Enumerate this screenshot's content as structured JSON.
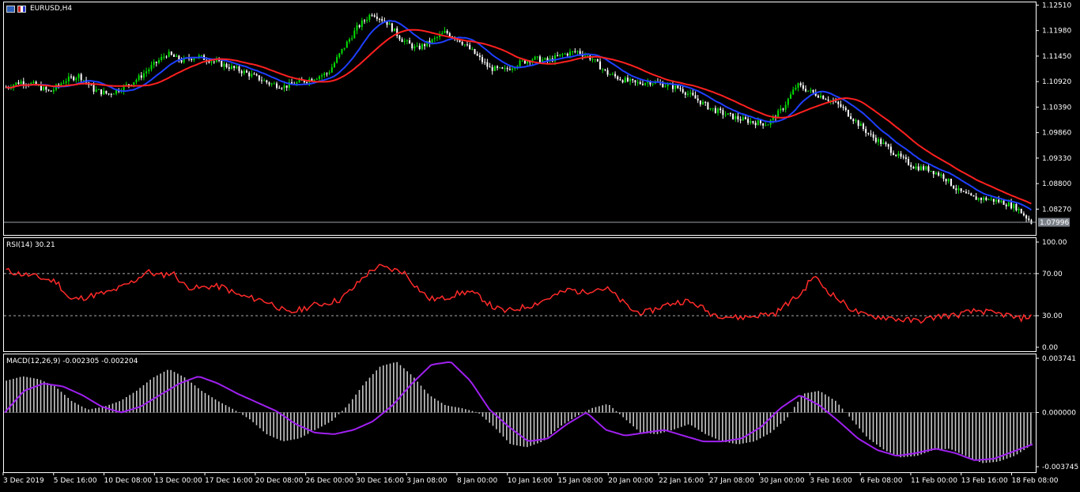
{
  "colors": {
    "background": "#000000",
    "candle_bull": "#00e000",
    "candle_bear": "#ffffff",
    "ma_fast": "#1f3fff",
    "ma_slow": "#ff2020",
    "rsi_line": "#ff2a2a",
    "macd_hist": "#c8c8c8",
    "macd_signal": "#a020f0",
    "frame": "#ffffff",
    "price_tag_bg": "#7a8088"
  },
  "main": {
    "symbol": "EURUSD,H4",
    "current_price": "1.07996",
    "price_ticks": [
      "1.12510",
      "1.11980",
      "1.11450",
      "1.10920",
      "1.10390",
      "1.09860",
      "1.09330",
      "1.08800",
      "1.08270"
    ]
  },
  "rsi": {
    "label": "RSI(14) 30.21",
    "ticks": [
      "100.00",
      "70.00",
      "30.00",
      "0.00"
    ]
  },
  "macd": {
    "label": "MACD(12,26,9) -0.002305 -0.002204",
    "ticks": [
      "0.003741",
      "0.000000",
      "-0.003745"
    ]
  },
  "time_axis": [
    "3 Dec 2019",
    "5 Dec 16:00",
    "10 Dec 08:00",
    "13 Dec 00:00",
    "17 Dec 16:00",
    "20 Dec 08:00",
    "26 Dec 00:00",
    "30 Dec 16:00",
    "3 Jan 08:00",
    "8 Jan 00:00",
    "10 Jan 16:00",
    "15 Jan 08:00",
    "20 Jan 00:00",
    "22 Jan 16:00",
    "27 Jan 08:00",
    "30 Jan 00:00",
    "3 Feb 16:00",
    "6 Feb 08:00",
    "11 Feb 00:00",
    "13 Feb 16:00",
    "18 Feb 08:00"
  ],
  "chart_data": [
    {
      "type": "line",
      "title": "EURUSD,H4",
      "ylim": [
        1.0775,
        1.1255
      ],
      "x_range": [
        "3 Dec 2019",
        "18 Feb 08:00"
      ],
      "series": [
        {
          "values": [
            1.108,
            1.1092,
            1.1085,
            1.107,
            1.1094,
            1.1105,
            1.1075,
            1.1066,
            1.108,
            1.1098,
            1.1125,
            1.115,
            1.1135,
            1.1145,
            1.1136,
            1.1125,
            1.1115,
            1.1102,
            1.1088,
            1.1082,
            1.109,
            1.11,
            1.111,
            1.116,
            1.1205,
            1.1235,
            1.1215,
            1.118,
            1.116,
            1.1175,
            1.1195,
            1.1178,
            1.115,
            1.112,
            1.1115,
            1.113,
            1.114,
            1.1135,
            1.1148,
            1.1155,
            1.114,
            1.111,
            1.1097,
            1.1088,
            1.1092,
            1.1085,
            1.1078,
            1.1058,
            1.1038,
            1.1025,
            1.1015,
            1.1008,
            1.1004,
            1.1035,
            1.1085,
            1.107,
            1.1058,
            1.104,
            1.101,
            1.098,
            1.096,
            1.0935,
            1.0915,
            1.091,
            1.0895,
            1.0865,
            1.085,
            1.0848,
            1.0842,
            1.083,
            1.08
          ]
        }
      ]
    },
    {
      "type": "line",
      "title": "RSI(14) 30.21",
      "ylim": [
        0,
        100
      ],
      "levels": [
        70,
        30
      ],
      "series": [
        {
          "values": [
            73,
            70,
            68,
            65,
            62,
            45,
            47,
            50,
            52,
            57,
            63,
            72,
            68,
            71,
            58,
            56,
            58,
            57,
            50,
            47,
            45,
            40,
            32,
            36,
            40,
            42,
            45,
            55,
            68,
            77,
            74,
            72,
            58,
            46,
            46,
            50,
            53,
            48,
            38,
            34,
            37,
            40,
            45,
            50,
            55,
            52,
            56,
            55,
            44,
            34,
            33,
            38,
            42,
            44,
            40,
            32,
            30,
            28,
            29,
            31,
            32,
            42,
            50,
            68,
            55,
            45,
            36,
            30,
            29,
            28,
            26,
            25,
            27,
            30,
            30,
            33,
            35,
            32,
            31,
            27,
            30
          ]
        }
      ]
    },
    {
      "type": "bar",
      "title": "MACD(12,26,9) -0.002305 -0.002204",
      "ylim": [
        -0.003745,
        0.003741
      ],
      "series": [
        {
          "values": [
            0.0022,
            0.0025,
            0.0023,
            0.0018,
            0.0008,
            0.0002,
            0.0004,
            0.0008,
            0.0015,
            0.0024,
            0.003,
            0.0024,
            0.0015,
            0.0008,
            0.0002,
            -0.0005,
            -0.0015,
            -0.002,
            -0.0018,
            -0.0012,
            -0.0006,
            0.0005,
            0.002,
            0.0032,
            0.0035,
            0.0025,
            0.0012,
            0.0005,
            0.0003,
            0.0,
            -0.001,
            -0.0022,
            -0.0024,
            -0.002,
            -0.001,
            -0.0003,
            0.0003,
            0.0006,
            -0.0004,
            -0.0014,
            -0.0015,
            -0.0012,
            -0.0008,
            -0.0015,
            -0.002,
            -0.0022,
            -0.002,
            -0.0014,
            -0.0004,
            0.0013,
            0.0015,
            0.0008,
            -0.0005,
            -0.0018,
            -0.0026,
            -0.0031,
            -0.003,
            -0.0026,
            -0.0025,
            -0.003,
            -0.0035,
            -0.0034,
            -0.003,
            -0.0023
          ]
        },
        {
          "values": [
            0.0,
            0.0015,
            0.002,
            0.0018,
            0.0012,
            0.0004,
            0.0,
            0.0004,
            0.0012,
            0.002,
            0.0025,
            0.002,
            0.0013,
            0.0007,
            0.0001,
            -0.0008,
            -0.0014,
            -0.0015,
            -0.0012,
            -0.0006,
            0.0005,
            0.002,
            0.0033,
            0.0035,
            0.0022,
            0.0002,
            -0.001,
            -0.002,
            -0.0018,
            -0.0008,
            0.0,
            -0.0012,
            -0.0016,
            -0.0014,
            -0.0012,
            -0.0016,
            -0.002,
            -0.002,
            -0.0018,
            -0.001,
            0.0003,
            0.0012,
            0.0005,
            -0.0006,
            -0.0018,
            -0.0026,
            -0.003,
            -0.0028,
            -0.0025,
            -0.0028,
            -0.0033,
            -0.0032,
            -0.0027,
            -0.0022
          ]
        }
      ]
    }
  ]
}
